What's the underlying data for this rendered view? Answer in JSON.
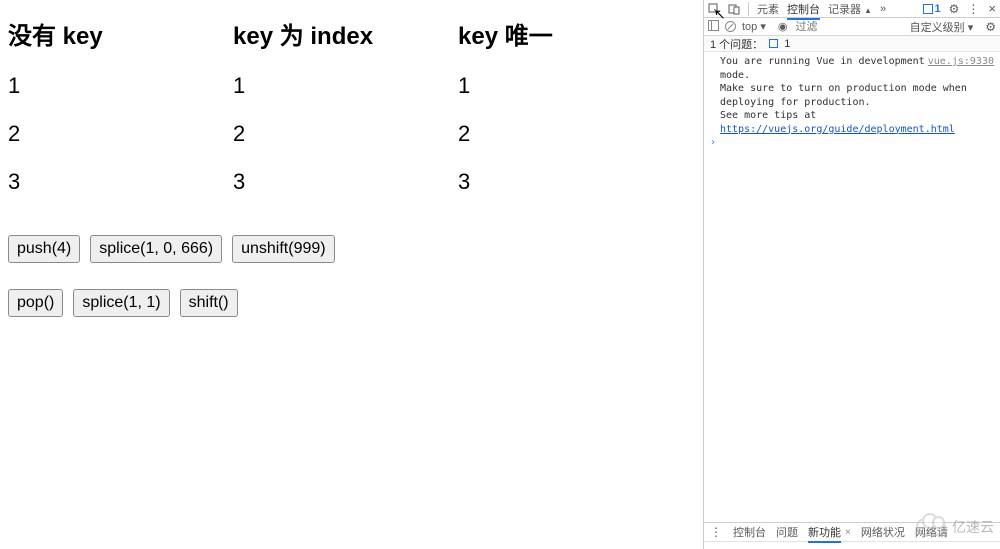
{
  "app": {
    "columns": [
      {
        "heading": "没有 key",
        "items": [
          "1",
          "2",
          "3"
        ]
      },
      {
        "heading": "key 为 index",
        "items": [
          "1",
          "2",
          "3"
        ]
      },
      {
        "heading": "key 唯一",
        "items": [
          "1",
          "2",
          "3"
        ]
      }
    ],
    "row1": {
      "push": "push(4)",
      "splice": "splice(1, 0, 666)",
      "unshift": "unshift(999)"
    },
    "row2": {
      "pop": "pop()",
      "splice": "splice(1, 1)",
      "shift": "shift()"
    }
  },
  "devtools": {
    "tabs": {
      "elements": "元素",
      "console": "控制台",
      "recorder": "记录器",
      "more": "»"
    },
    "badge_count": "1",
    "toolbar": {
      "context": "top ▾",
      "filter_placeholder": "过滤",
      "level": "自定义级别 ▾"
    },
    "issues": {
      "label": "1 个问题：",
      "count": "1"
    },
    "console": {
      "source": "vue.js:9330",
      "line1": "You are running Vue in development mode.",
      "line2": "Make sure to turn on production mode when deploying for production.",
      "line3_prefix": "See more tips at ",
      "line3_link": "https://vuejs.org/guide/deployment.html"
    },
    "drawer": {
      "console": "控制台",
      "issues": "问题",
      "whatsnew": "新功能",
      "network": "网络状况",
      "requestblocking": "网络请"
    }
  },
  "watermark": "亿速云"
}
